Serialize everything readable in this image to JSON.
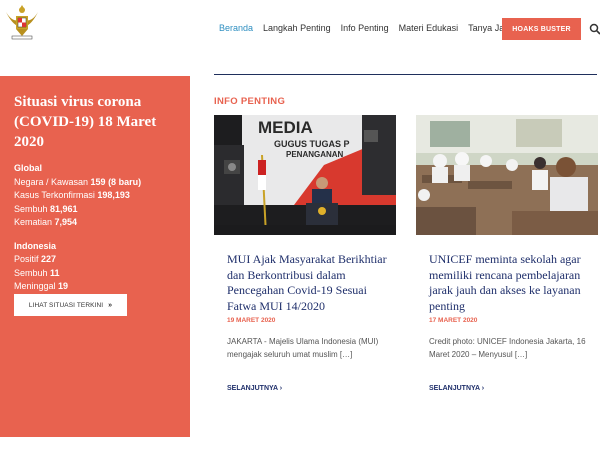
{
  "header": {
    "logo": "garuda-emblem",
    "nav": [
      "Beranda",
      "Langkah Penting",
      "Info Penting",
      "Materi Edukasi",
      "Tanya Jawab"
    ],
    "active_index": 0,
    "cta": "HOAKS BUSTER",
    "search_icon": "search-icon"
  },
  "panel": {
    "title": "Situasi virus corona (COVID-19) 18 Maret 2020",
    "global": {
      "heading": "Global",
      "rows": [
        {
          "label": "Negara / Kawasan ",
          "value": "159 (8 baru)"
        },
        {
          "label": "Kasus Terkonfirmasi ",
          "value": "198,193"
        },
        {
          "label": "Sembuh ",
          "value": "81,961"
        },
        {
          "label": "Kematian ",
          "value": "7,954"
        }
      ]
    },
    "indonesia": {
      "heading": "Indonesia",
      "rows": [
        {
          "label": "Positif ",
          "value": "227"
        },
        {
          "label": "Sembuh ",
          "value": "11"
        },
        {
          "label": "Meninggal ",
          "value": "19"
        }
      ]
    },
    "button": "LIHAT SITUASI TERKINI",
    "button_arrow": "»"
  },
  "main": {
    "section_title": "INFO PENTING",
    "cards": [
      {
        "image_text_1": "MEDIA",
        "image_text_2": "GUGUS TUGAS P",
        "image_text_3": "PENANGANAN",
        "title": "MUI Ajak Masyarakat Berikhtiar dan Berkontribusi dalam Pencegahan Covid-19 Sesuai Fatwa MUI 14/2020",
        "date": "19 MARET 2020",
        "excerpt": "JAKARTA - Majelis Ulama Indonesia (MUI) mengajak seluruh umat muslim […]",
        "more": "SELANJUTNYA ›"
      },
      {
        "title": "UNICEF meminta sekolah agar memiliki rencana pembelajaran jarak jauh dan akses ke layanan penting",
        "date": "17 MARET 2020",
        "excerpt": "Credit photo: UNICEF Indonesia Jakarta, 16 Maret 2020 – Menyusul […]",
        "more": "SELANJUTNYA ›"
      }
    ]
  },
  "colors": {
    "accent": "#e8624f",
    "navy": "#1f2f6b",
    "link_active": "#2f8fc1"
  }
}
